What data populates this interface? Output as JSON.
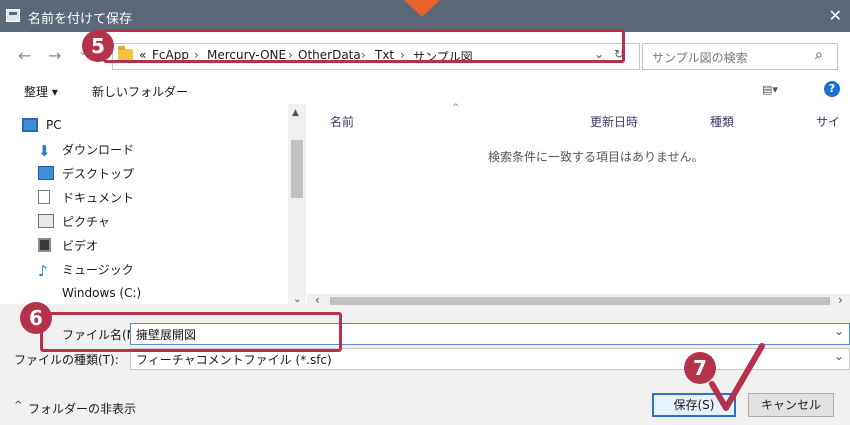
{
  "titlebar": {
    "title": "名前を付けて保存",
    "close_glyph": "✕"
  },
  "nav": {
    "back": "←",
    "forward": "→",
    "recent": "⌄",
    "refresh": "↻",
    "dropdown": "⌄"
  },
  "address": {
    "overflow": "«",
    "crumbs": [
      "FcApp",
      "Mercury-ONE",
      "OtherData",
      "Txt",
      "サンプル図"
    ],
    "separator": "›"
  },
  "search": {
    "placeholder": "サンプル図の検索",
    "icon": "⌕"
  },
  "toolbar": {
    "organize": "整理 ▾",
    "new_folder": "新しいフォルダー",
    "view_glyph": "▤▾",
    "help": "?"
  },
  "sidebar": {
    "items": [
      {
        "label": "PC",
        "icon": "pc-icon"
      },
      {
        "label": "ダウンロード",
        "icon": "download-icon"
      },
      {
        "label": "デスクトップ",
        "icon": "desktop-icon"
      },
      {
        "label": "ドキュメント",
        "icon": "document-icon"
      },
      {
        "label": "ピクチャ",
        "icon": "picture-icon"
      },
      {
        "label": "ビデオ",
        "icon": "video-icon"
      },
      {
        "label": "ミュージック",
        "icon": "music-icon"
      },
      {
        "label": "Windows (C:)",
        "icon": "drive-icon"
      }
    ]
  },
  "file_list": {
    "columns": [
      "名前",
      "更新日時",
      "種類",
      "サイ"
    ],
    "empty_message": "検索条件に一致する項目はありません。",
    "sort_glyph": "^"
  },
  "form": {
    "filename_label": "ファイル名(N):",
    "filename_value": "擁壁展開図",
    "filetype_label": "ファイルの種類(T):",
    "filetype_value": "フィーチャコメントファイル (*.sfc)",
    "chevron": "⌄"
  },
  "footer": {
    "hide_folders": "フォルダーの非表示",
    "hide_glyph": "^",
    "save": "保存(S)",
    "cancel": "キャンセル"
  },
  "annotations": {
    "badge5": "5",
    "badge6": "6",
    "badge7": "7",
    "accent": "#b5334a",
    "arrow": "#e8622a",
    "check": "#b5334a"
  }
}
